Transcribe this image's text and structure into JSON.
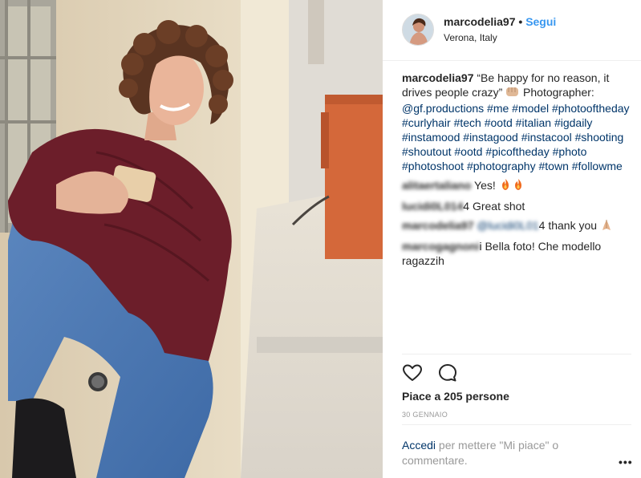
{
  "post": {
    "username": "marcodelia97",
    "separator": "•",
    "follow_label": "Segui",
    "location": "Verona, Italy",
    "caption": {
      "username": "marcodelia97",
      "text_1": " “Be happy for no reason, it drives people crazy” ",
      "text_2": " Photographer: ",
      "mention": "@gf.productions",
      "hashtags": [
        "#me",
        "#model",
        "#photooftheday",
        "#curlyhair",
        "#tech",
        "#ootd",
        "#italian",
        "#igdaily",
        "#instamood",
        "#instagood",
        "#instacool",
        "#shooting",
        "#shoutout",
        "#ootd",
        "#picoftheday",
        "#photo",
        "#photoshoot",
        "#photography",
        "#town",
        "#followme"
      ]
    },
    "comments": [
      {
        "username": "alitaertaliano",
        "text": " Yes! "
      },
      {
        "username": "lucidi0L014",
        "text": "4 Great shot"
      },
      {
        "username": "marcodelia97",
        "mention": "@lucidi0L01",
        "text": "4 thank you "
      },
      {
        "username": "marcogagnoni",
        "text": "i Bella foto! Che modello ragazzih"
      }
    ],
    "likes_text": "Piace a 205 persone",
    "date": "30 GENNAIO",
    "login_link": "Accedi",
    "login_text": " per mettere \"Mi piace\" o commentare.",
    "more_label": "•••"
  },
  "icons": {
    "like": "heart-outline-icon",
    "comment": "speech-bubble-icon",
    "more": "more-options-icon"
  },
  "colors": {
    "link_blue": "#3897f0",
    "hashtag_blue": "#003569",
    "text": "#262626",
    "muted": "#999999",
    "divider": "#efefef"
  }
}
